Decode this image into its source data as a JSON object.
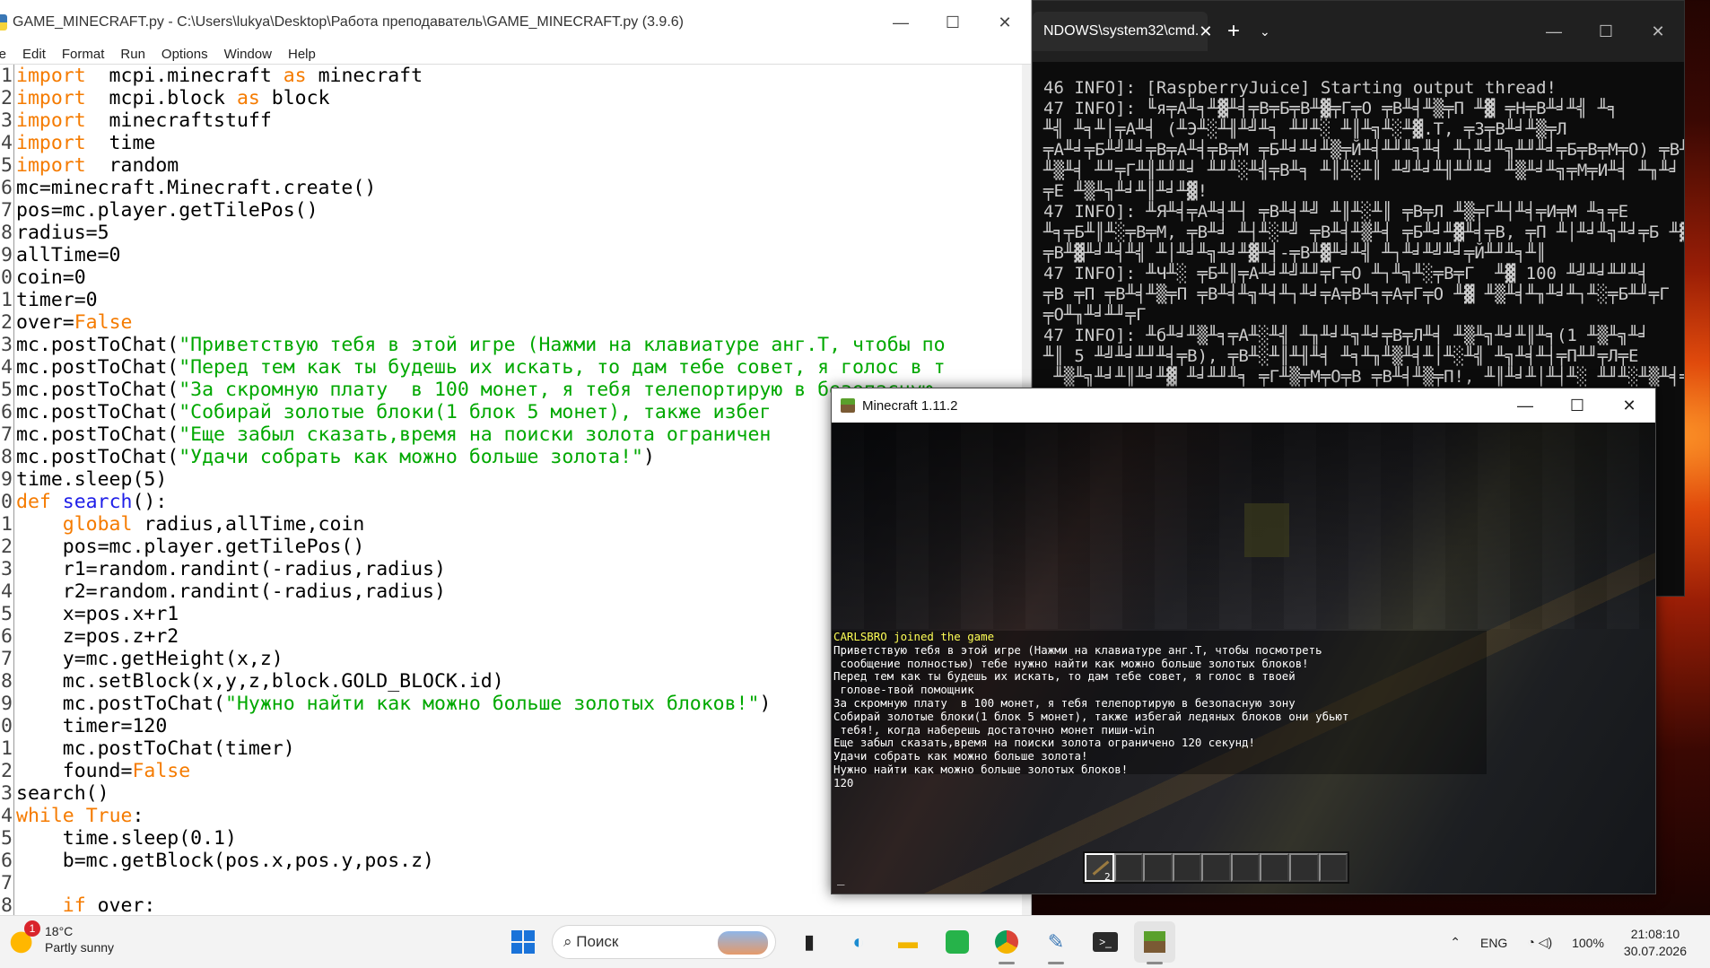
{
  "idle": {
    "title": "GAME_MINECRAFT.py - C:\\Users\\lukya\\Desktop\\Работа преподаватель\\GAME_MINECRAFT.py (3.9.6)",
    "controls": [
      "—",
      "☐",
      "✕"
    ],
    "menu": [
      "ile",
      "Edit",
      "Format",
      "Run",
      "Options",
      "Window",
      "Help"
    ],
    "line_numbers": [
      "1",
      "2",
      "3",
      "4",
      "5",
      "6",
      "7",
      "8",
      "9",
      "0",
      "1",
      "2",
      "3",
      "4",
      "5",
      "6",
      "7",
      "8",
      "9",
      "0",
      "1",
      "2",
      "3",
      "4",
      "5",
      "6",
      "7",
      "8",
      "9",
      "0",
      "1",
      "2",
      "3",
      "4",
      "5",
      "6",
      "7",
      "8"
    ],
    "code_lines": [
      [
        [
          "kw",
          "import"
        ],
        [
          "",
          "  mcpi.minecraft "
        ],
        [
          "kw",
          "as"
        ],
        [
          "",
          " minecraft"
        ]
      ],
      [
        [
          "kw",
          "import"
        ],
        [
          "",
          "  mcpi.block "
        ],
        [
          "kw",
          "as"
        ],
        [
          "",
          " block"
        ]
      ],
      [
        [
          "kw",
          "import"
        ],
        [
          "",
          "  minecraftstuff"
        ]
      ],
      [
        [
          "kw",
          "import"
        ],
        [
          "",
          "  time"
        ]
      ],
      [
        [
          "kw",
          "import"
        ],
        [
          "",
          "  random"
        ]
      ],
      [
        [
          "",
          "mc=minecraft.Minecraft.create()"
        ]
      ],
      [
        [
          "",
          "pos=mc.player.getTilePos()"
        ]
      ],
      [
        [
          "",
          "radius=5"
        ]
      ],
      [
        [
          "",
          "allTime=0"
        ]
      ],
      [
        [
          "",
          "coin=0"
        ]
      ],
      [
        [
          "",
          "timer=0"
        ]
      ],
      [
        [
          "",
          "over="
        ],
        [
          "kw",
          "False"
        ]
      ],
      [
        [
          "",
          "mc.postToChat("
        ],
        [
          "st",
          "\"Приветствую тебя в этой игре (Нажми на клавиатуре анг.T, чтобы по"
        ]
      ],
      [
        [
          "",
          "mc.postToChat("
        ],
        [
          "st",
          "\"Перед тем как ты будешь их искать, то дам тебе совет, я голос в т"
        ]
      ],
      [
        [
          "",
          "mc.postToChat("
        ],
        [
          "st",
          "\"За скромную плату  в 100 монет, я тебя телепортирую в безопасную"
        ]
      ],
      [
        [
          "",
          "mc.postToChat("
        ],
        [
          "st",
          "\"Собирай золотые блоки(1 блок 5 монет), также избег"
        ]
      ],
      [
        [
          "",
          "mc.postToChat("
        ],
        [
          "st",
          "\"Еще забыл сказать,время на поиски золота ограничен"
        ]
      ],
      [
        [
          "",
          "mc.postToChat("
        ],
        [
          "st",
          "\"Удачи собрать как можно больше золота!\""
        ],
        [
          "",
          ")"
        ]
      ],
      [
        [
          "",
          "time.sleep(5)"
        ]
      ],
      [
        [
          "kw",
          "def"
        ],
        [
          "",
          " "
        ],
        [
          "df",
          "search"
        ],
        [
          "",
          "():"
        ]
      ],
      [
        [
          "",
          "    "
        ],
        [
          "kw",
          "global"
        ],
        [
          "",
          " radius,allTime,coin"
        ]
      ],
      [
        [
          "",
          "    pos=mc.player.getTilePos()"
        ]
      ],
      [
        [
          "",
          "    r1=random.randint(-radius,radius)"
        ]
      ],
      [
        [
          "",
          "    r2=random.randint(-radius,radius)"
        ]
      ],
      [
        [
          "",
          "    x=pos.x+r1"
        ]
      ],
      [
        [
          "",
          "    z=pos.z+r2"
        ]
      ],
      [
        [
          "",
          "    y=mc.getHeight(x,z)"
        ]
      ],
      [
        [
          "",
          "    mc.setBlock(x,y,z,block.GOLD_BLOCK.id)"
        ]
      ],
      [
        [
          "",
          "    mc.postToChat("
        ],
        [
          "st",
          "\"Нужно найти как можно больше золотых блоков!\""
        ],
        [
          "",
          ")"
        ]
      ],
      [
        [
          "",
          "    timer=120"
        ]
      ],
      [
        [
          "",
          "    mc.postToChat(timer)"
        ]
      ],
      [
        [
          "",
          "    found="
        ],
        [
          "kw",
          "False"
        ]
      ],
      [
        [
          "",
          "search()"
        ]
      ],
      [
        [
          "kw",
          "while"
        ],
        [
          "",
          " "
        ],
        [
          "kw",
          "True"
        ],
        [
          "",
          ":"
        ]
      ],
      [
        [
          "",
          "    time.sleep(0.1)"
        ]
      ],
      [
        [
          "",
          "    b=mc.getBlock(pos.x,pos.y,pos.z)"
        ]
      ],
      [
        [
          "",
          ""
        ]
      ],
      [
        [
          "",
          "    "
        ],
        [
          "kw",
          "if"
        ],
        [
          "",
          " over:"
        ]
      ]
    ]
  },
  "cmd": {
    "tab_title": "NDOWS\\system32\\cmd.",
    "tab_close": "✕",
    "new_tab": "+",
    "dropdown": "⌄",
    "controls": [
      "—",
      "☐",
      "✕"
    ],
    "output": "46 INFO]: [RaspberryJuice] Starting output thread!\n47 INFO]: ╙я╤А╨╕╨▓╨╡╤В╤Б╤В╨▓╤Г╤О ╤В╨╡╨▒╤П ╨▓ ╤Н╤В╨╛╨╣ ╨╕\n╨╣ ╨╕╨│╤А╨╡ (╨Э╨░╨╢╨╝╨╕ ╨╜╨░ ╨║╨╗╨░╨▓.T, ╤З╤В╨╛╨▒╤Л\n╤А╨╛╤Б╨╝╨╛╤В╤А╨╡╤В╤М ╤Б╨╛╨╛╨▒╤Й╨╡╨╜╨╕╨╡ ╨┐╨╛╨╗╨╜╨╛╤Б╤В╤М╤О) ╤В╨╡\n╨▒╨╡ ╨╜╤Г╨╢╨╜╨╛ ╨╜╨░╨╣╤В╨╕ ╨║╨░╨║ ╨╝╨╛╨╢╨╜╨╛ ╨▒╨╛╨╗╤М╤И╨╡ ╨╖╨╛\n╤Е ╨▒╨╗╨╛╨║╨╛╨▓!\n47 INFO]: ╨Я╨╡╤А╨╡╨┤ ╤В╨╡╨╝ ╨║╨░╨║ ╤В╤Л ╨▒╤Г╨┤╨╡╤И╤М ╨╕╤Е\n╨╕╤Б╨║╨░╤В╤М, ╤В╨╛ ╨┤╨░╨╝ ╤В╨╡╨▒╨╡ ╤Б╨╛╨▓╨╡╤В, ╤П ╨│╨╛╨╗╨╛╤Б ╨▓\n╤В╨▓╨╛╨╡╨╣ ╨│╨╛╨╗╨╛╨▓╨╡-╤В╨▓╨╛╨╣ ╨┐╨╛╨╝╨╛╤Й╨╜╨╕╨║\n47 INFO]: ╨Ч╨░ ╤Б╨║╤А╨╛╨╝╨╜╤Г╤О ╨┐╨╗╨░╤В╤Г  ╨▓ 100 ╨╝╨╛╨╜╨╡\n╤В ╤П ╤В╨╡╨▒╤П ╤В╨╡╨╗╨╡╨┐╨╛╤А╤В╨╕╤А╤Г╤О ╨▓ ╨▒╨╡╨╖╨╛╨┐╨░╤Б╨╜╤Г\n╤О╨╖╨╛╨╜╤Г\n47 INFO]: ╨б╨╛╨▒╨╕╤А╨░╨╣ ╨╖╨╛╨╗╨╛╤В╤Л╨╡ ╨▒╨╗╨╛╨║╨╕(1 ╨▒╨╗╨╛\n╨║ 5 ╨╝╨╛╨╜╨╡╤В), ╤В╨░╨║╨╢╨╡ ╨╕╨╖╨▒╨╡╨│╨░╨╣ ╨╗╨╡╨┤╤П╨╜╤Л╤Е\n ╨▒╨╗╨╛╨║╨╛╨▓ ╨╛╨╜╨╕ ╤Г╨▒╤М╤О╤В ╤В╨╡╨▒╤П!, ╨║╨╛╨│╨┤╨░ ╨╜╨░╨▒╨╡╤А"
  },
  "minecraft": {
    "title": "Minecraft 1.11.2",
    "controls": [
      "—",
      "☐",
      "✕"
    ],
    "chat": [
      "CARLSBRO joined the game",
      "Приветствую тебя в этой игре (Нажми на клавиатуре анг.T, чтобы посмотреть",
      " сообщение полностью) тебе нужно найти как можно больше золотых блоков!",
      "Перед тем как ты будешь их искать, то дам тебе совет, я голос в твоей",
      " голове-твой помощник",
      "За скромную плату  в 100 монет, я тебя телепортирую в безопасную зону",
      "Собирай золотые блоки(1 блок 5 монет), также избегай ледяных блоков они убьют",
      " тебя!, когда наберешь достаточно монет пиши-win",
      "Еще забыл сказать,время на поиски золота ограничено 120 секунд!",
      "Удачи собрать как можно больше золота!",
      "Нужно найти как можно больше золотых блоков!",
      "120"
    ],
    "chat_cursor": "_",
    "hotbar_slots": 9,
    "hotbar_selected": 0,
    "hotbar_count": "2"
  },
  "taskbar": {
    "weather_temp": "18°C",
    "weather_desc": "Partly sunny",
    "weather_badge": "1",
    "search_placeholder": "Поиск",
    "lang": "ENG",
    "battery": "100%",
    "time": "21:08:10",
    "date": "30.07.2026",
    "icons": [
      "windows-start-icon",
      "search-box",
      "task-view-icon",
      "edge-icon",
      "file-explorer-icon",
      "whatsapp-icon",
      "chrome-icon",
      "idle-icon",
      "terminal-icon",
      "minecraft-icon"
    ]
  }
}
